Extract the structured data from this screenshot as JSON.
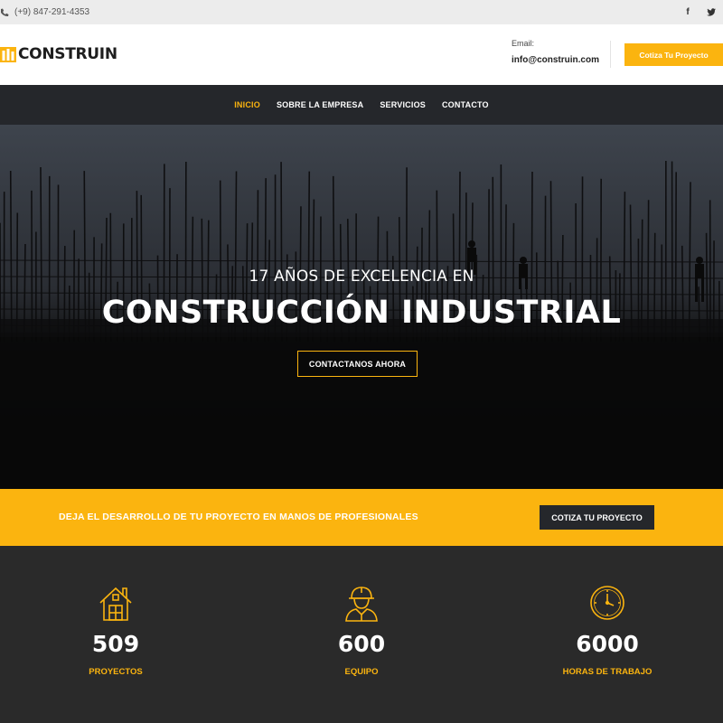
{
  "topbar": {
    "phone": "(+9) 847-291-4353",
    "social": [
      {
        "icon": "facebook-icon",
        "glyph": "f"
      },
      {
        "icon": "twitter-icon",
        "glyph": "t"
      }
    ]
  },
  "header": {
    "logo_text": "CONSTRUIN",
    "email_label": "Email:",
    "email_value": "info@construin.com",
    "cta_label": "Cotiza Tu Proyecto"
  },
  "nav": {
    "items": [
      {
        "label": "INICIO",
        "active": true
      },
      {
        "label": "SOBRE LA EMPRESA",
        "active": false
      },
      {
        "label": "SERVICIOS",
        "active": false
      },
      {
        "label": "CONTACTO",
        "active": false
      }
    ]
  },
  "hero": {
    "subtitle": "17 AÑOS DE EXCELENCIA EN",
    "title": "CONSTRUCCIÓN INDUSTRIAL",
    "button_label": "CONTACTANOS AHORA"
  },
  "banner": {
    "text": "DEJA EL DESARROLLO DE TU PROYECTO EN MANOS DE PROFESIONALES",
    "button_label": "COTIZA TU PROYECTO"
  },
  "stats": [
    {
      "icon": "house-icon",
      "value": "509",
      "label": "PROYECTOS"
    },
    {
      "icon": "worker-icon",
      "value": "600",
      "label": "EQUIPO"
    },
    {
      "icon": "clock-icon",
      "value": "6000",
      "label": "HORAS DE TRABAJO"
    }
  ],
  "colors": {
    "accent": "#fbb40f",
    "dark": "#25272b",
    "stats_bg": "#2a2a2a"
  }
}
